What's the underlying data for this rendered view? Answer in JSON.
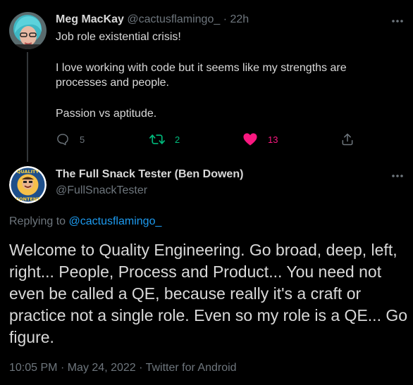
{
  "tweet1": {
    "author_name": "Meg MacKay",
    "author_handle": "@cactusflamingo_",
    "separator": "·",
    "time": "22h",
    "more": "•••",
    "lines": [
      "Job role existential crisis!",
      "I love working with code but it seems like my strengths are",
      "processes and people.",
      "Passion vs aptitude."
    ],
    "actions": {
      "reply_count": "5",
      "retweet_count": "2",
      "like_count": "13"
    },
    "colors": {
      "retweet": "#00ba7c",
      "like": "#f91880"
    }
  },
  "tweet2": {
    "author_name": "The Full Snack Tester (Ben Dowen)",
    "author_handle": "@FullSnackTester",
    "more": "•••",
    "replying_prefix": "Replying to",
    "replying_to": "@cactusflamingo_",
    "body": "Welcome to Quality Engineering. Go broad, deep, left, right... People, Process and Product... You need not even be called a QE, because really it's a craft or practice not a single role. Even so my role is a QE... Go figure.",
    "time": "10:05 PM",
    "date": "May 24, 2022",
    "source": "Twitter for Android",
    "dot": "·",
    "avatar_text": [
      "QUALITY",
      "CONTENT"
    ]
  }
}
